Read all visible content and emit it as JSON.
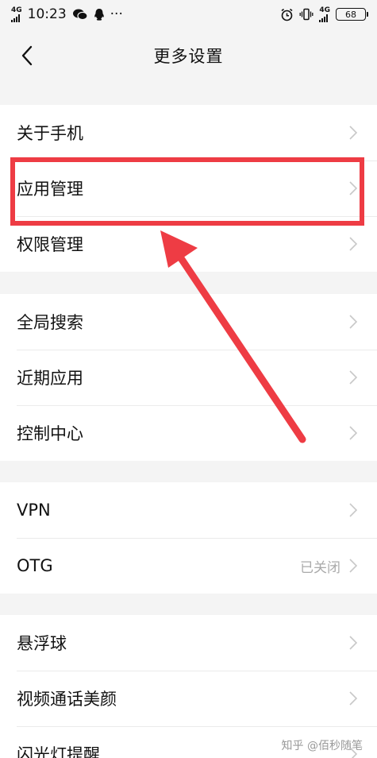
{
  "status_bar": {
    "signal_label": "4G",
    "signal_sub": "HD",
    "time": "10:23",
    "dots": "···",
    "network_right": "4G",
    "battery": "68"
  },
  "header": {
    "title": "更多设置"
  },
  "groups": [
    {
      "items": [
        {
          "label": "关于手机"
        },
        {
          "label": "应用管理"
        },
        {
          "label": "权限管理"
        }
      ]
    },
    {
      "items": [
        {
          "label": "全局搜索"
        },
        {
          "label": "近期应用"
        },
        {
          "label": "控制中心"
        }
      ]
    },
    {
      "items": [
        {
          "label": "VPN"
        },
        {
          "label": "OTG",
          "value": "已关闭"
        }
      ]
    },
    {
      "items": [
        {
          "label": "悬浮球"
        },
        {
          "label": "视频通话美颜"
        },
        {
          "label": "闪光灯提醒"
        }
      ]
    }
  ],
  "watermark": "知乎 @佰秒随笔",
  "colors": {
    "highlight": "#ee3c44",
    "background": "#f4f4f4",
    "row_bg": "#ffffff",
    "chevron": "#c8c8c8"
  }
}
